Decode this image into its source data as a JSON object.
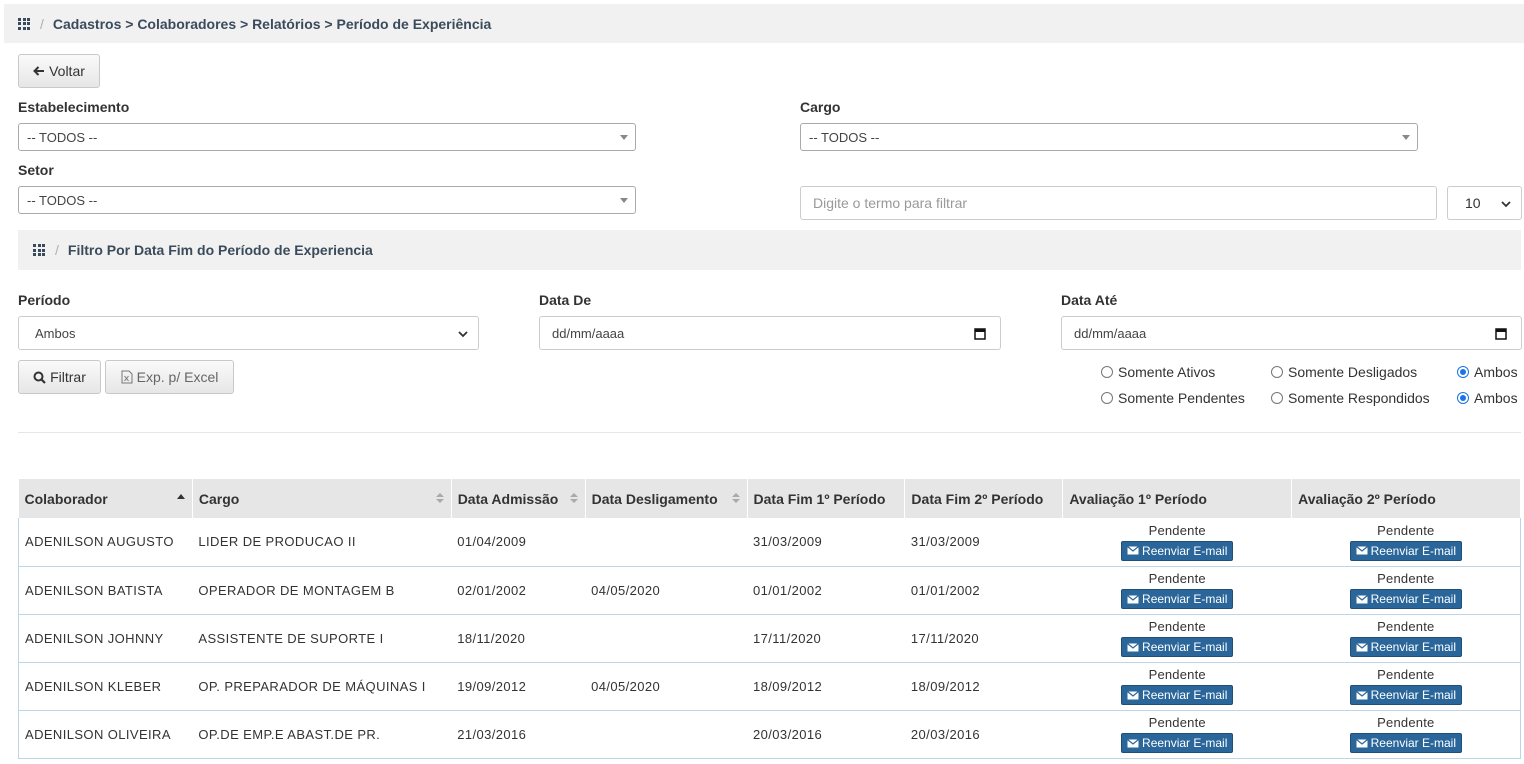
{
  "breadcrumb": {
    "text": "Cadastros > Colaboradores > Relatórios > Período de Experiência"
  },
  "buttons": {
    "back": "Voltar",
    "filter": "Filtrar",
    "export": "Exp. p/ Excel"
  },
  "fields": {
    "estabelecimento": {
      "label": "Estabelecimento",
      "value": "-- TODOS --"
    },
    "cargo": {
      "label": "Cargo",
      "value": "-- TODOS --"
    },
    "setor": {
      "label": "Setor",
      "value": "-- TODOS --"
    },
    "search": {
      "placeholder": "Digite o termo para filtrar"
    },
    "page_size": {
      "value": "10"
    }
  },
  "subfilter": {
    "title": "Filtro Por Data Fim do Período de Experiencia"
  },
  "periodo": {
    "label": "Período",
    "value": "Ambos"
  },
  "data_de": {
    "label": "Data De",
    "value": "dd/mm/aaaa"
  },
  "data_ate": {
    "label": "Data Até",
    "value": "dd/mm/aaaa"
  },
  "radios": {
    "status": [
      "Somente Ativos",
      "Somente Desligados",
      "Ambos"
    ],
    "status_selected": "Ambos",
    "resposta": [
      "Somente Pendentes",
      "Somente Respondidos",
      "Ambos"
    ],
    "resposta_selected": "Ambos"
  },
  "table": {
    "columns": [
      "Colaborador",
      "Cargo",
      "Data Admissão",
      "Data Desligamento",
      "Data Fim 1º Período",
      "Data Fim 2º Período",
      "Avaliação 1º Período",
      "Avaliação 2º Período"
    ],
    "rows": [
      {
        "colaborador": "ADENILSON AUGUSTO",
        "cargo": "LIDER DE PRODUCAO II",
        "admissao": "01/04/2009",
        "desligamento": "",
        "fim1": "31/03/2009",
        "fim2": "31/03/2009",
        "av1": "Pendente",
        "av2": "Pendente"
      },
      {
        "colaborador": "ADENILSON BATISTA",
        "cargo": "OPERADOR DE MONTAGEM B",
        "admissao": "02/01/2002",
        "desligamento": "04/05/2020",
        "fim1": "01/01/2002",
        "fim2": "01/01/2002",
        "av1": "Pendente",
        "av2": "Pendente"
      },
      {
        "colaborador": "ADENILSON JOHNNY",
        "cargo": "ASSISTENTE DE SUPORTE I",
        "admissao": "18/11/2020",
        "desligamento": "",
        "fim1": "17/11/2020",
        "fim2": "17/11/2020",
        "av1": "Pendente",
        "av2": "Pendente"
      },
      {
        "colaborador": "ADENILSON KLEBER",
        "cargo": "OP. PREPARADOR DE MÁQUINAS I",
        "admissao": "19/09/2012",
        "desligamento": "04/05/2020",
        "fim1": "18/09/2012",
        "fim2": "18/09/2012",
        "av1": "Pendente",
        "av2": "Pendente"
      },
      {
        "colaborador": "ADENILSON OLIVEIRA",
        "cargo": "OP.DE EMP.E ABAST.DE PR.",
        "admissao": "21/03/2016",
        "desligamento": "",
        "fim1": "20/03/2016",
        "fim2": "20/03/2016",
        "av1": "Pendente",
        "av2": "Pendente"
      }
    ],
    "resend_label": "Reenviar E-mail"
  }
}
